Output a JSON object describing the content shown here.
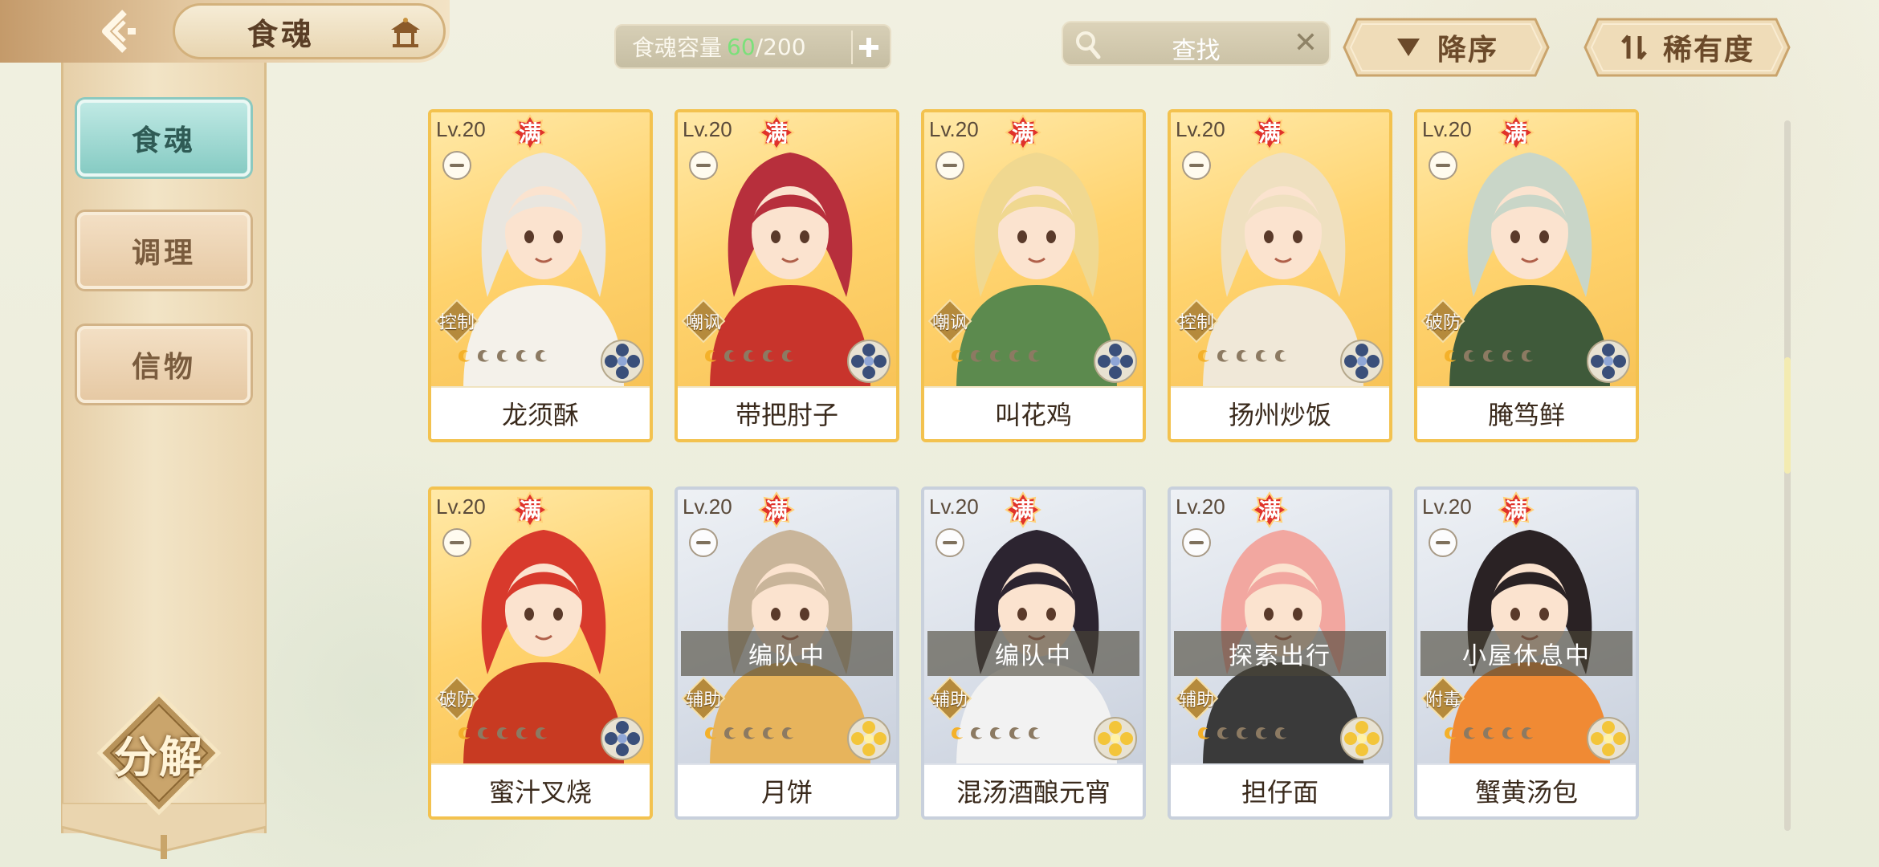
{
  "header": {
    "title": "食魂",
    "capacity_label": "食魂容量",
    "capacity_current": "60",
    "capacity_max": "/200",
    "search_placeholder": "查找",
    "sort_order_label": "降序",
    "sort_by_label": "稀有度"
  },
  "sidebar": {
    "tabs": [
      {
        "label": "食魂",
        "active": true
      },
      {
        "label": "调理",
        "active": false
      },
      {
        "label": "信物",
        "active": false
      }
    ],
    "decompose_label": "分解"
  },
  "cards": [
    {
      "level": "Lv.20",
      "full": "满",
      "role": "控制",
      "name": "龙须酥",
      "rarity": "gold",
      "element": "dark",
      "status": "",
      "hair": "#e9e6df",
      "cloth": "#f4f1ea"
    },
    {
      "level": "Lv.20",
      "full": "满",
      "role": "嘲讽",
      "name": "带把肘子",
      "rarity": "gold",
      "element": "dark",
      "status": "",
      "hair": "#b72f3c",
      "cloth": "#c8342c"
    },
    {
      "level": "Lv.20",
      "full": "满",
      "role": "嘲讽",
      "name": "叫花鸡",
      "rarity": "gold",
      "element": "dark",
      "status": "",
      "hair": "#f0d890",
      "cloth": "#5c8a4e"
    },
    {
      "level": "Lv.20",
      "full": "满",
      "role": "控制",
      "name": "扬州炒饭",
      "rarity": "gold",
      "element": "dark",
      "status": "",
      "hair": "#efe0c0",
      "cloth": "#f0e8d8"
    },
    {
      "level": "Lv.20",
      "full": "满",
      "role": "破防",
      "name": "腌笃鲜",
      "rarity": "gold",
      "element": "dark",
      "status": "",
      "hair": "#c9d6c8",
      "cloth": "#3f5a3a"
    },
    {
      "level": "Lv.20",
      "full": "满",
      "role": "破防",
      "name": "蜜汁叉烧",
      "rarity": "gold",
      "element": "dark",
      "status": "",
      "hair": "#d83a2c",
      "cloth": "#c83a22"
    },
    {
      "level": "Lv.20",
      "full": "满",
      "role": "辅助",
      "name": "月饼",
      "rarity": "silver",
      "element": "light",
      "status": "编队中",
      "hair": "#c9b59a",
      "cloth": "#e7b45c"
    },
    {
      "level": "Lv.20",
      "full": "满",
      "role": "辅助",
      "name": "混汤酒酿元宵",
      "rarity": "silver",
      "element": "light",
      "status": "编队中",
      "hair": "#2c2430",
      "cloth": "#f2f2f2"
    },
    {
      "level": "Lv.20",
      "full": "满",
      "role": "辅助",
      "name": "担仔面",
      "rarity": "silver",
      "element": "light",
      "status": "探索出行",
      "hair": "#f2a7a0",
      "cloth": "#3a3a3a"
    },
    {
      "level": "Lv.20",
      "full": "满",
      "role": "附毒",
      "name": "蟹黄汤包",
      "rarity": "silver",
      "element": "light",
      "status": "小屋休息中",
      "hair": "#2a2224",
      "cloth": "#f08a34"
    }
  ],
  "colors": {
    "gold_border": "#f3c24f",
    "silver_border": "#c8d0dc",
    "active_tab": "#86cbc3",
    "capacity_current": "#7be07a",
    "role_badge": "#b58a3c"
  }
}
